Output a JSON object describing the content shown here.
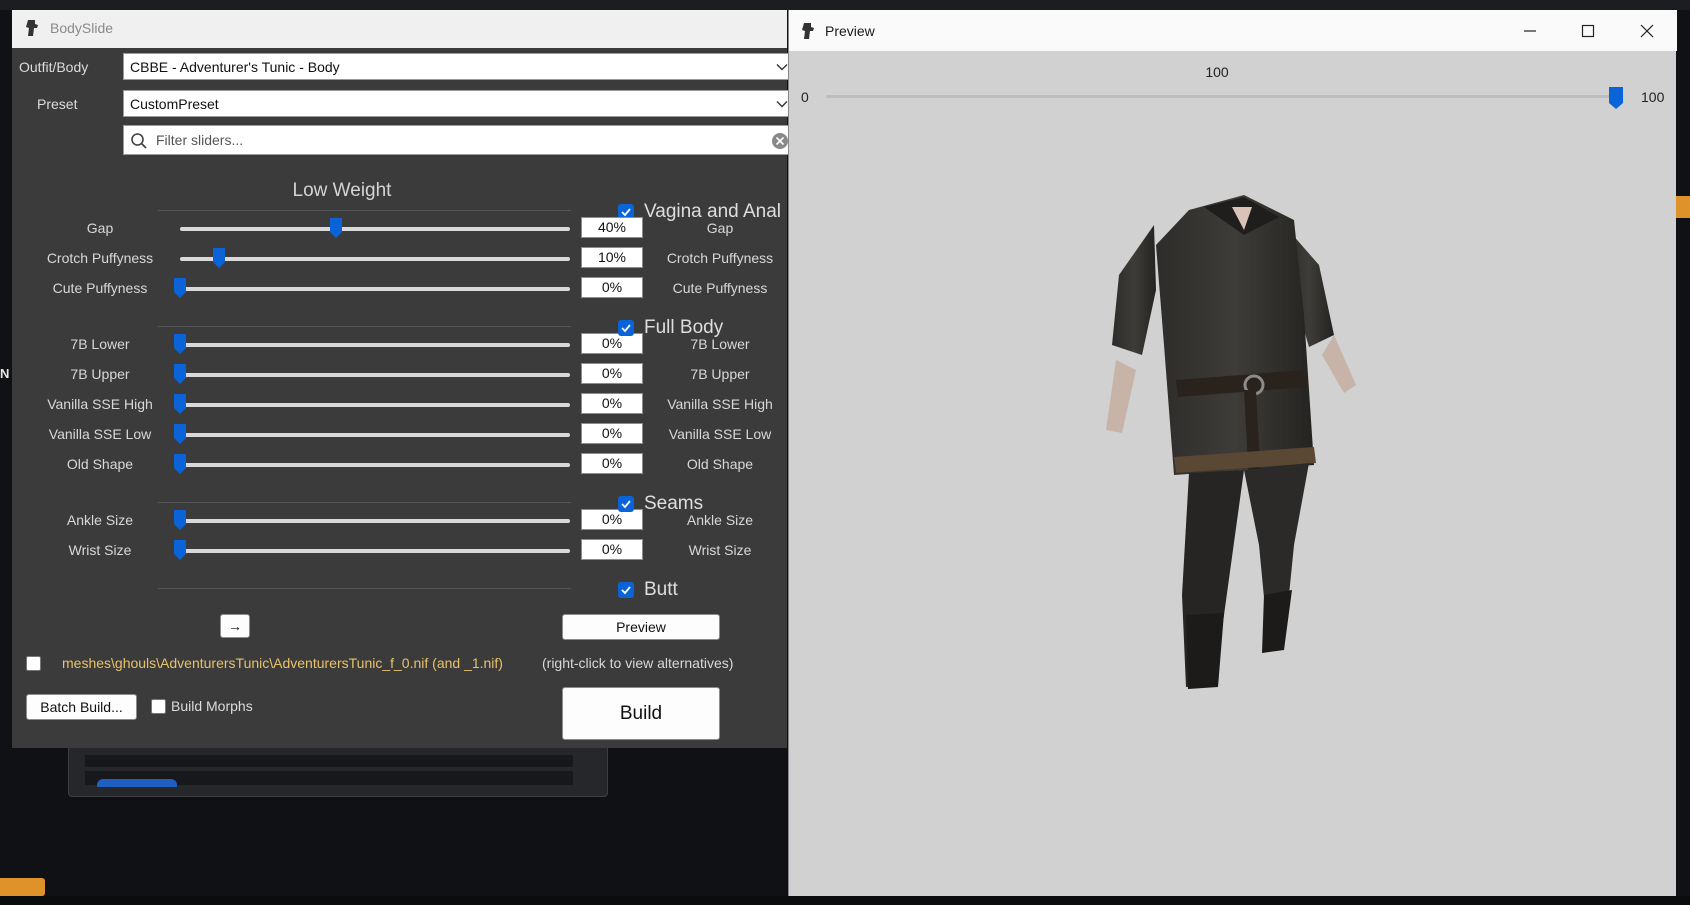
{
  "bodyslide": {
    "title": "BodySlide",
    "outfit_label": "Outfit/Body",
    "outfit_value": "CBBE - Adventurer's Tunic - Body",
    "preset_label": "Preset",
    "preset_value": "CustomPreset",
    "filter_placeholder": "Filter sliders...",
    "weight_header": "Low Weight",
    "groups": {
      "vagina_anal": "Vagina and Anal",
      "full_body": "Full Body",
      "seams": "Seams",
      "butt": "Butt"
    },
    "sliders": [
      {
        "name": "Gap",
        "value": "40%",
        "level": 40
      },
      {
        "name": "Crotch Puffyness",
        "value": "10%",
        "level": 10
      },
      {
        "name": "Cute Puffyness",
        "value": "0%",
        "level": 0
      },
      {
        "name": "7B Lower",
        "value": "0%",
        "level": 0
      },
      {
        "name": "7B Upper",
        "value": "0%",
        "level": 0
      },
      {
        "name": "Vanilla SSE High",
        "value": "0%",
        "level": 0
      },
      {
        "name": "Vanilla SSE Low",
        "value": "0%",
        "level": 0
      },
      {
        "name": "Old Shape",
        "value": "0%",
        "level": 0
      },
      {
        "name": "Ankle Size",
        "value": "0%",
        "level": 0
      },
      {
        "name": "Wrist Size",
        "value": "0%",
        "level": 0
      }
    ],
    "arrow_label": "→",
    "preview_label": "Preview",
    "output_path": "meshes\\ghouls\\AdventurersTunic\\AdventurersTunic_f_0.nif (and _1.nif)",
    "output_hint": "(right-click to view alternatives)",
    "batch_build_label": "Batch Build...",
    "build_morphs_label": "Build Morphs",
    "build_label": "Build"
  },
  "preview": {
    "title": "Preview",
    "weight_value": "100",
    "min_label": "0",
    "max_label": "100",
    "weight_level": 100
  },
  "colors": {
    "accent": "#0a64d8",
    "path_text": "#e8c26b",
    "panel_bg": "#3b3b3b",
    "preview_bg": "#d1d1d1"
  }
}
